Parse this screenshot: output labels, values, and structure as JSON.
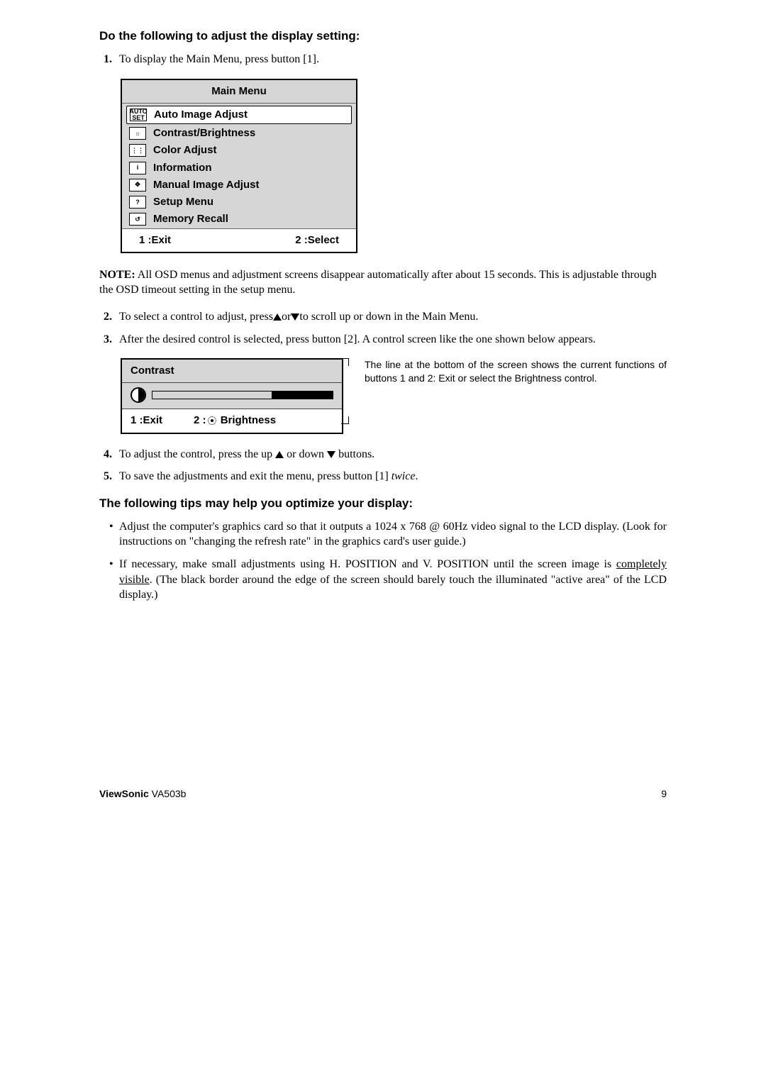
{
  "heading1": "Do the following to adjust the display setting:",
  "step1": "To display the Main Menu, press button [1].",
  "mainMenu": {
    "title": "Main Menu",
    "items": [
      {
        "icon": "AUTO SET",
        "label": "Auto Image Adjust",
        "highlight": true
      },
      {
        "icon": "☼",
        "label": "Contrast/Brightness"
      },
      {
        "icon": "⋮⋮",
        "label": "Color Adjust"
      },
      {
        "icon": "i",
        "label": "Information"
      },
      {
        "icon": "✥",
        "label": "Manual Image Adjust"
      },
      {
        "icon": "?",
        "label": "Setup Menu"
      },
      {
        "icon": "↺",
        "label": "Memory Recall"
      }
    ],
    "footerLeft": "1 :Exit",
    "footerRight": "2 :Select"
  },
  "notePrefix": "NOTE:",
  "noteBody": " All OSD menus and adjustment screens disappear automatically after about 15 seconds. This is adjustable through the OSD timeout setting in the setup menu.",
  "step2a": "To select a control to adjust, press",
  "step2b": "or",
  "step2c": "to scroll up or down in the Main Menu.",
  "step3": "After the desired control is selected, press button [2]. A control screen like the one shown below appears.",
  "contrast": {
    "title": "Contrast",
    "footerLeft": "1 :Exit",
    "footerRightA": "2 :",
    "footerRightB": " Brightness"
  },
  "callout": "The line at the bottom of the screen shows the current functions of buttons 1 and 2: Exit or select the Brightness control.",
  "step4a": "To adjust the control, press the up ",
  "step4b": " or down ",
  "step4c": " buttons.",
  "step5a": "To save the adjustments and exit the menu, press button [1] ",
  "step5twice": "twice",
  "step5c": ".",
  "heading2": "The following tips may help you optimize your display:",
  "tip1": "Adjust the computer's graphics card so that it outputs a 1024 x 768 @ 60Hz video signal to the LCD display. (Look for instructions on \"changing the refresh rate\" in the graphics card's user guide.)",
  "tip2a": "If necessary, make small adjustments using H. POSITION and V. POSITION until the screen image is ",
  "tip2u": "completely visible",
  "tip2b": ". (The black border around the edge of the screen should barely touch the illuminated \"active area\" of the LCD display.)",
  "footer": {
    "brand": "ViewSonic",
    "model": "   VA503b",
    "page": "9"
  }
}
